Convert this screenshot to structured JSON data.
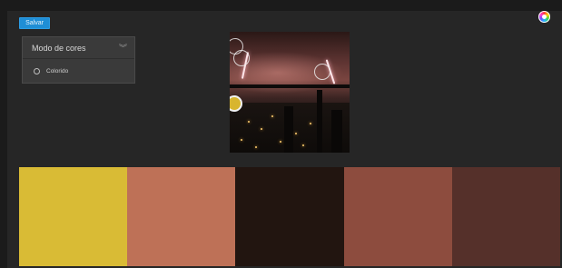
{
  "toolbar": {
    "save_label": "Salvar"
  },
  "mode_panel": {
    "title": "Modo de cores",
    "chevron_icon": "chevron-double-down-icon",
    "options": [
      {
        "label": "Colorido",
        "selected": false
      }
    ]
  },
  "icons": {
    "color_wheel": "color-wheel-icon"
  },
  "swatches": [
    {
      "color": "#d9bb35"
    },
    {
      "color": "#be7157"
    },
    {
      "color": "#221510"
    },
    {
      "color": "#8d4c3e"
    },
    {
      "color": "#55302a"
    }
  ]
}
